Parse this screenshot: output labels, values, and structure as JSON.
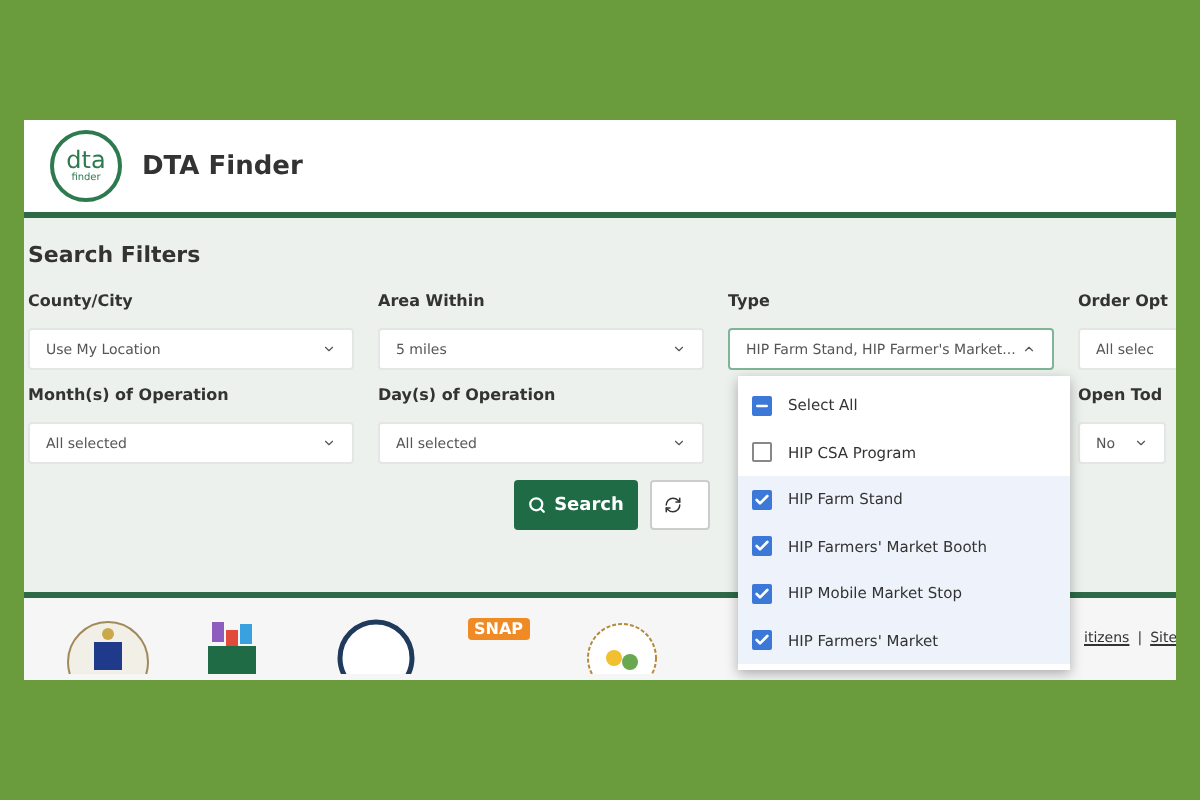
{
  "header": {
    "logo_text": "dta",
    "logo_subtext": "finder",
    "title": "DTA Finder"
  },
  "filters": {
    "heading": "Search Filters",
    "rows": [
      [
        {
          "label": "County/City",
          "value": "Use My Location",
          "open": false
        },
        {
          "label": "Area Within",
          "value": "5 miles",
          "open": false
        },
        {
          "label": "Type",
          "value": "HIP Farm Stand, HIP Farmer's Market...",
          "open": true
        },
        {
          "label": "Order Opt",
          "value": "All selec",
          "open": false
        }
      ],
      [
        {
          "label": "Month(s) of Operation",
          "value": "All selected",
          "open": false
        },
        {
          "label": "Day(s) of Operation",
          "value": "All selected",
          "open": false
        },
        null,
        {
          "label": "Open Tod",
          "value": "No",
          "open": false,
          "narrow": true
        }
      ]
    ],
    "search_button": "Search"
  },
  "type_dropdown": {
    "select_all": {
      "label": "Select All",
      "indeterminate": true
    },
    "options": [
      {
        "label": "HIP CSA Program",
        "checked": false
      },
      {
        "label": "HIP Farm Stand",
        "checked": true
      },
      {
        "label": "HIP Farmers' Market Booth",
        "checked": true
      },
      {
        "label": "HIP Mobile Market Stop",
        "checked": true
      },
      {
        "label": "HIP Farmers' Market",
        "checked": true
      }
    ]
  },
  "footer": {
    "snap_badge": "SNAP",
    "links": [
      "itizens",
      "Site"
    ],
    "link_separator": "|"
  }
}
